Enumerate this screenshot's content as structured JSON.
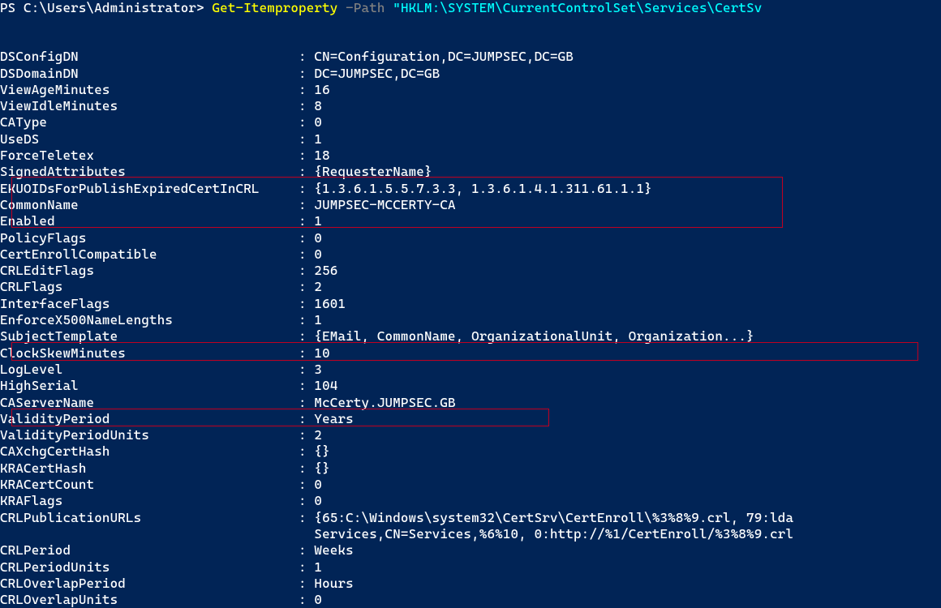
{
  "prompt": {
    "prefix": "PS C:\\Users\\Administrator> ",
    "cmdlet": "Get-Itemproperty",
    "param_name": " -Path ",
    "param_value": "\"HKLM:\\SYSTEM\\CurrentControlSet\\Services\\CertSv"
  },
  "rows": [
    {
      "key": "DSConfigDN",
      "val": "CN=Configuration,DC=JUMPSEC,DC=GB"
    },
    {
      "key": "DSDomainDN",
      "val": "DC=JUMPSEC,DC=GB"
    },
    {
      "key": "ViewAgeMinutes",
      "val": "16"
    },
    {
      "key": "ViewIdleMinutes",
      "val": "8"
    },
    {
      "key": "CAType",
      "val": "0"
    },
    {
      "key": "UseDS",
      "val": "1"
    },
    {
      "key": "ForceTeletex",
      "val": "18"
    },
    {
      "key": "SignedAttributes",
      "val": "{RequesterName}"
    },
    {
      "key": "EKUOIDsForPublishExpiredCertInCRL",
      "val": "{1.3.6.1.5.5.7.3.3, 1.3.6.1.4.1.311.61.1.1}"
    },
    {
      "key": "CommonName",
      "val": "JUMPSEC-MCCERTY-CA"
    },
    {
      "key": "Enabled",
      "val": "1"
    },
    {
      "key": "PolicyFlags",
      "val": "0"
    },
    {
      "key": "CertEnrollCompatible",
      "val": "0"
    },
    {
      "key": "CRLEditFlags",
      "val": "256"
    },
    {
      "key": "CRLFlags",
      "val": "2"
    },
    {
      "key": "InterfaceFlags",
      "val": "1601"
    },
    {
      "key": "EnforceX500NameLengths",
      "val": "1"
    },
    {
      "key": "SubjectTemplate",
      "val": "{EMail, CommonName, OrganizationalUnit, Organization...}"
    },
    {
      "key": "ClockSkewMinutes",
      "val": "10"
    },
    {
      "key": "LogLevel",
      "val": "3"
    },
    {
      "key": "HighSerial",
      "val": "104"
    },
    {
      "key": "CAServerName",
      "val": "McCerty.JUMPSEC.GB"
    },
    {
      "key": "ValidityPeriod",
      "val": "Years"
    },
    {
      "key": "ValidityPeriodUnits",
      "val": "2"
    },
    {
      "key": "CAXchgCertHash",
      "val": "{}"
    },
    {
      "key": "KRACertHash",
      "val": "{}"
    },
    {
      "key": "KRACertCount",
      "val": "0"
    },
    {
      "key": "KRAFlags",
      "val": "0"
    },
    {
      "key": "CRLPublicationURLs",
      "val": "{65:C:\\Windows\\system32\\CertSrv\\CertEnroll\\%3%8%9.crl, 79:lda"
    },
    {
      "key": "",
      "val": "Services,CN=Services,%6%10, 0:http://%1/CertEnroll/%3%8%9.crl"
    },
    {
      "key": "CRLPeriod",
      "val": "Weeks"
    },
    {
      "key": "CRLPeriodUnits",
      "val": "1"
    },
    {
      "key": "CRLOverlapPeriod",
      "val": "Hours"
    },
    {
      "key": "CRLOverlapUnits",
      "val": "0"
    }
  ]
}
